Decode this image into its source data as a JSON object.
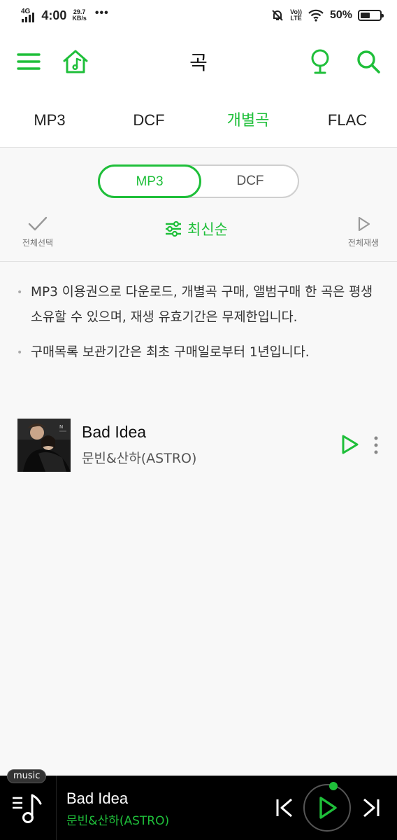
{
  "status_bar": {
    "network": "4G",
    "time": "4:00",
    "speed_value": "29.7",
    "speed_unit": "KB/s",
    "dots": "•••",
    "volte_top": "Vo))",
    "volte_bottom": "LTE",
    "battery": "50%",
    "battery_level": 0.5
  },
  "header": {
    "title": "곡",
    "icons": [
      "menu-icon",
      "home-music-icon",
      "microphone-icon",
      "search-icon"
    ]
  },
  "tabs": [
    {
      "label": "MP3",
      "active": false
    },
    {
      "label": "DCF",
      "active": false
    },
    {
      "label": "개별곡",
      "active": true
    },
    {
      "label": "FLAC",
      "active": false
    }
  ],
  "format_toggle": {
    "options": [
      "MP3",
      "DCF"
    ],
    "selected": "MP3"
  },
  "actions": {
    "select_all": "전체선택",
    "sort": "최신순",
    "play_all": "전체재생"
  },
  "notices": [
    "MP3 이용권으로 다운로드, 개별곡 구매, 앨범구매 한 곡은 평생 소유할 수 있으며, 재생 유효기간은 무제한입니다.",
    "구매목록 보관기간은 최초 구매일로부터 1년입니다."
  ],
  "tracks": [
    {
      "title": "Bad Idea",
      "artist": "문빈&산하(ASTRO)"
    }
  ],
  "mini_player": {
    "badge": "music",
    "title": "Bad Idea",
    "artist": "문빈&산하(ASTRO)"
  },
  "colors": {
    "accent": "#1fbf3a",
    "player_bg": "#000000"
  }
}
